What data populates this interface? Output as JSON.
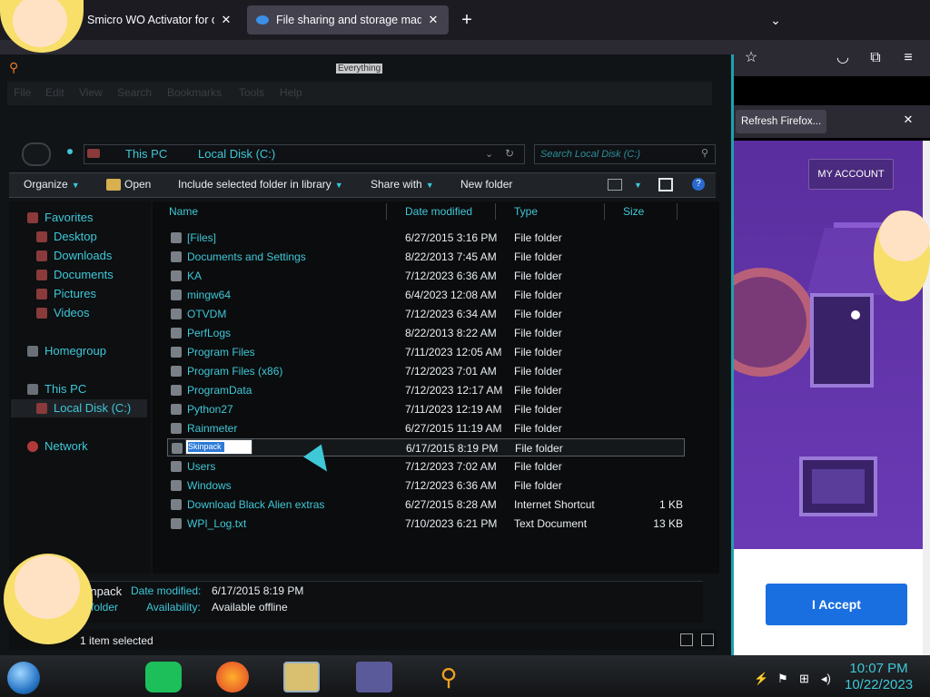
{
  "browser": {
    "tabs": [
      {
        "title": "Smicro WO Activator for offi",
        "active": false
      },
      {
        "title": "File sharing and storage made s",
        "active": true
      }
    ],
    "new_tab_label": "+",
    "tab_list_icon": "chevron-down-icon",
    "close_glyph": "✕",
    "notification": {
      "refresh_label": "Refresh Firefox..."
    }
  },
  "webpage": {
    "my_account_label": "MY ACCOUNT",
    "accept_label": "I Accept"
  },
  "explorer": {
    "app_title": "Everything",
    "menu": [
      "File",
      "Edit",
      "View",
      "Search",
      "Bookmarks",
      "Tools",
      "Help"
    ],
    "breadcrumb": [
      "This PC",
      "Local Disk (C:)"
    ],
    "search_placeholder": "Search Local Disk (C:)",
    "toolbar": {
      "organize": "Organize",
      "open": "Open",
      "include": "Include selected folder in library",
      "share": "Share with",
      "new_folder": "New folder"
    },
    "nav": {
      "favorites": "Favorites",
      "desktop": "Desktop",
      "downloads": "Downloads",
      "documents": "Documents",
      "pictures": "Pictures",
      "videos": "Videos",
      "homegroup": "Homegroup",
      "this_pc": "This PC",
      "local_disk": "Local Disk (C:)",
      "network": "Network"
    },
    "columns": {
      "name": "Name",
      "date": "Date modified",
      "type": "Type",
      "size": "Size"
    },
    "files": [
      {
        "name": "[Files]",
        "date": "6/27/2015 3:16 PM",
        "type": "File folder",
        "size": ""
      },
      {
        "name": "Documents and Settings",
        "date": "8/22/2013 7:45 AM",
        "type": "File folder",
        "size": ""
      },
      {
        "name": "KA",
        "date": "7/12/2023 6:36 AM",
        "type": "File folder",
        "size": ""
      },
      {
        "name": "mingw64",
        "date": "6/4/2023 12:08 AM",
        "type": "File folder",
        "size": ""
      },
      {
        "name": "OTVDM",
        "date": "7/12/2023 6:34 AM",
        "type": "File folder",
        "size": ""
      },
      {
        "name": "PerfLogs",
        "date": "8/22/2013 8:22 AM",
        "type": "File folder",
        "size": ""
      },
      {
        "name": "Program Files",
        "date": "7/11/2023 12:05 AM",
        "type": "File folder",
        "size": ""
      },
      {
        "name": "Program Files (x86)",
        "date": "7/12/2023 7:01 AM",
        "type": "File folder",
        "size": ""
      },
      {
        "name": "ProgramData",
        "date": "7/12/2023 12:17 AM",
        "type": "File folder",
        "size": ""
      },
      {
        "name": "Python27",
        "date": "7/11/2023 12:19 AM",
        "type": "File folder",
        "size": ""
      },
      {
        "name": "Rainmeter",
        "date": "6/27/2015 11:19 AM",
        "type": "File folder",
        "size": ""
      },
      {
        "name": "",
        "date": "6/17/2015 8:19 PM",
        "type": "File folder",
        "size": "",
        "renaming": true
      },
      {
        "name": "Users",
        "date": "7/12/2023 7:02 AM",
        "type": "File folder",
        "size": ""
      },
      {
        "name": "Windows",
        "date": "7/12/2023 6:36 AM",
        "type": "File folder",
        "size": ""
      },
      {
        "name": "Download Black Alien extras",
        "date": "6/27/2015 8:28 AM",
        "type": "Internet Shortcut",
        "size": "1 KB"
      },
      {
        "name": "WPI_Log.txt",
        "date": "7/10/2023 6:21 PM",
        "type": "Text Document",
        "size": "13 KB"
      }
    ],
    "rename_value": "Skinpack",
    "details": {
      "name": "kinpack",
      "date_label": "Date modified:",
      "date_value": "6/17/2015 8:19 PM",
      "type_label": "e folder",
      "availability_label": "Availability:",
      "availability_value": "Available offline"
    },
    "status": "1 item selected"
  },
  "taskbar": {
    "time": "10:07 PM",
    "date": "10/22/2023"
  },
  "colors": {
    "accent": "#3ec8d8",
    "purple": "#5b2fa3",
    "accept": "#1a6fe0"
  }
}
